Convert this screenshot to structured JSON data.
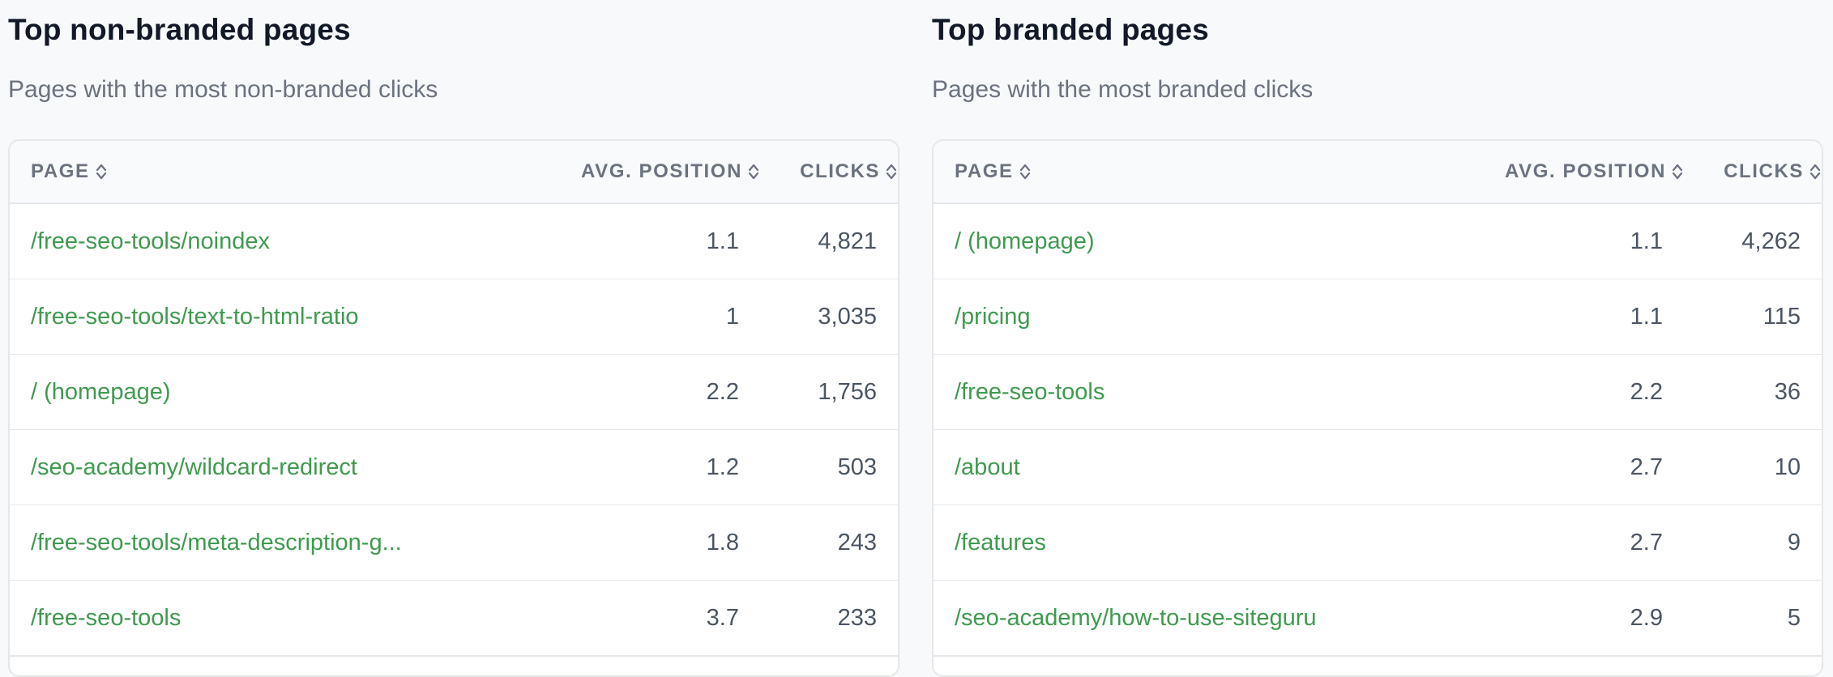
{
  "non_branded": {
    "title": "Top non-branded pages",
    "subtitle": "Pages with the most non-branded clicks",
    "columns": {
      "page": "PAGE",
      "position": "AVG. POSITION",
      "clicks": "CLICKS"
    },
    "rows": [
      {
        "page": "/free-seo-tools/noindex",
        "position": "1.1",
        "clicks": "4,821"
      },
      {
        "page": "/free-seo-tools/text-to-html-ratio",
        "position": "1",
        "clicks": "3,035"
      },
      {
        "page": "/ (homepage)",
        "position": "2.2",
        "clicks": "1,756"
      },
      {
        "page": "/seo-academy/wildcard-redirect",
        "position": "1.2",
        "clicks": "503"
      },
      {
        "page": "/free-seo-tools/meta-description-g...",
        "position": "1.8",
        "clicks": "243"
      },
      {
        "page": "/free-seo-tools",
        "position": "3.7",
        "clicks": "233"
      }
    ]
  },
  "branded": {
    "title": "Top branded pages",
    "subtitle": "Pages with the most branded clicks",
    "columns": {
      "page": "PAGE",
      "position": "AVG. POSITION",
      "clicks": "CLICKS"
    },
    "rows": [
      {
        "page": "/ (homepage)",
        "position": "1.1",
        "clicks": "4,262"
      },
      {
        "page": "/pricing",
        "position": "1.1",
        "clicks": "115"
      },
      {
        "page": "/free-seo-tools",
        "position": "2.2",
        "clicks": "36"
      },
      {
        "page": "/about",
        "position": "2.7",
        "clicks": "10"
      },
      {
        "page": "/features",
        "position": "2.7",
        "clicks": "9"
      },
      {
        "page": "/seo-academy/how-to-use-siteguru",
        "position": "2.9",
        "clicks": "5"
      }
    ]
  },
  "colors": {
    "link": "#3f9a4f",
    "header_text": "#6b7280",
    "border": "#e5e7eb",
    "background": "#f8f9fb"
  },
  "icons": {
    "sort": "sort-icon"
  }
}
